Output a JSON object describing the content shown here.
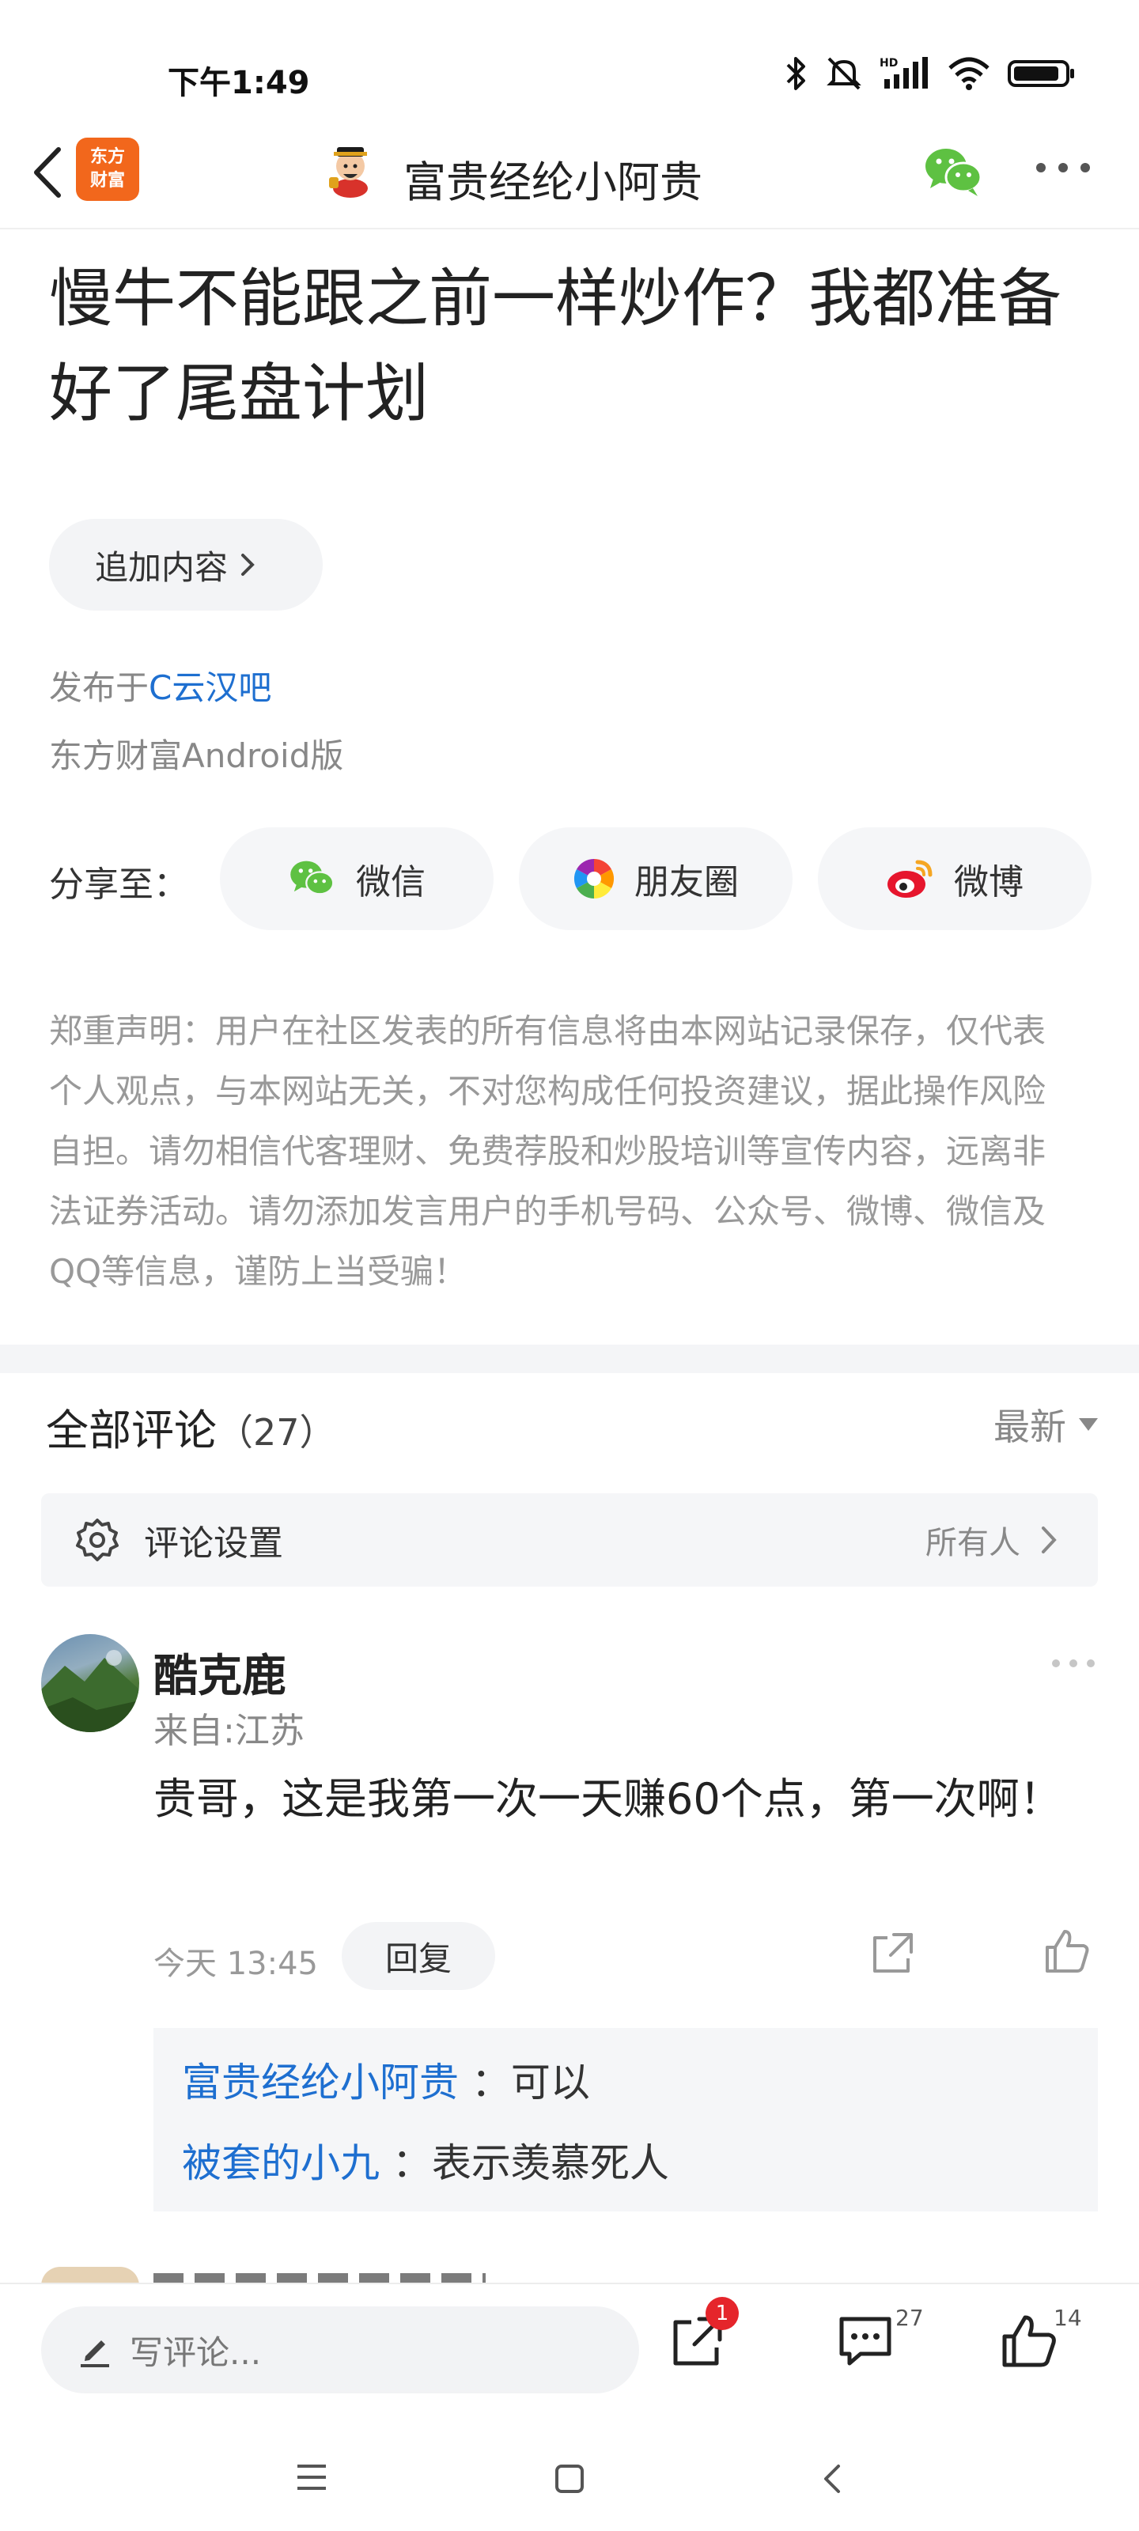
{
  "status_bar": {
    "time": "下午1:49",
    "icons": [
      "bluetooth-icon",
      "mute-bell-icon",
      "hd-signal-icon",
      "wifi-icon",
      "battery-icon"
    ]
  },
  "navbar": {
    "app_logo_line1": "东方",
    "app_logo_line2": "财富",
    "title": "富贵经纶小阿贵",
    "icons": [
      "back-icon",
      "wechat-icon",
      "more-icon"
    ]
  },
  "article": {
    "title": "慢牛不能跟之前一样炒作？我都准备好了尾盘计划",
    "add_content_label": "追加内容",
    "posted_in_prefix": "发布于",
    "posted_in_bar": "C云汉吧",
    "source": "东方财富Android版"
  },
  "share": {
    "label": "分享至：",
    "targets": [
      {
        "label": "微信",
        "icon": "wechat-icon"
      },
      {
        "label": "朋友圈",
        "icon": "moments-icon"
      },
      {
        "label": "微博",
        "icon": "weibo-icon"
      }
    ]
  },
  "disclaimer": "郑重声明：用户在社区发表的所有信息将由本网站记录保存，仅代表个人观点，与本网站无关，不对您构成任何投资建议，据此操作风险自担。请勿相信代客理财、免费荐股和炒股培训等宣传内容，远离非法证券活动。请勿添加发言用户的手机号码、公众号、微博、微信及QQ等信息，谨防上当受骗！",
  "comments": {
    "header": "全部评论",
    "count": "（27）",
    "sort_label": "最新",
    "settings_label": "评论设置",
    "settings_value": "所有人",
    "items": [
      {
        "author": "酷克鹿",
        "location": "来自:江苏",
        "text": "贵哥，这是我第一次一天赚60个点，第一次啊！",
        "time": "今天 13:45",
        "reply_label": "回复",
        "replies": [
          {
            "name": "富贵经纶小阿贵",
            "sep": "：",
            "text": "可以"
          },
          {
            "name": "被套的小九",
            "sep": "：",
            "text": "表示羡慕死人"
          }
        ]
      }
    ]
  },
  "bottom_bar": {
    "input_placeholder": "写评论...",
    "share_badge": "1",
    "comment_count": "27",
    "like_count": "14"
  },
  "system_nav": {
    "icons": [
      "menu-icon",
      "home-icon",
      "back-icon"
    ]
  },
  "colors": {
    "accent_blue": "#1e6fd0",
    "brand_orange": "#f2671c",
    "badge_red": "#e5252b",
    "wechat_green": "#5ec142"
  }
}
